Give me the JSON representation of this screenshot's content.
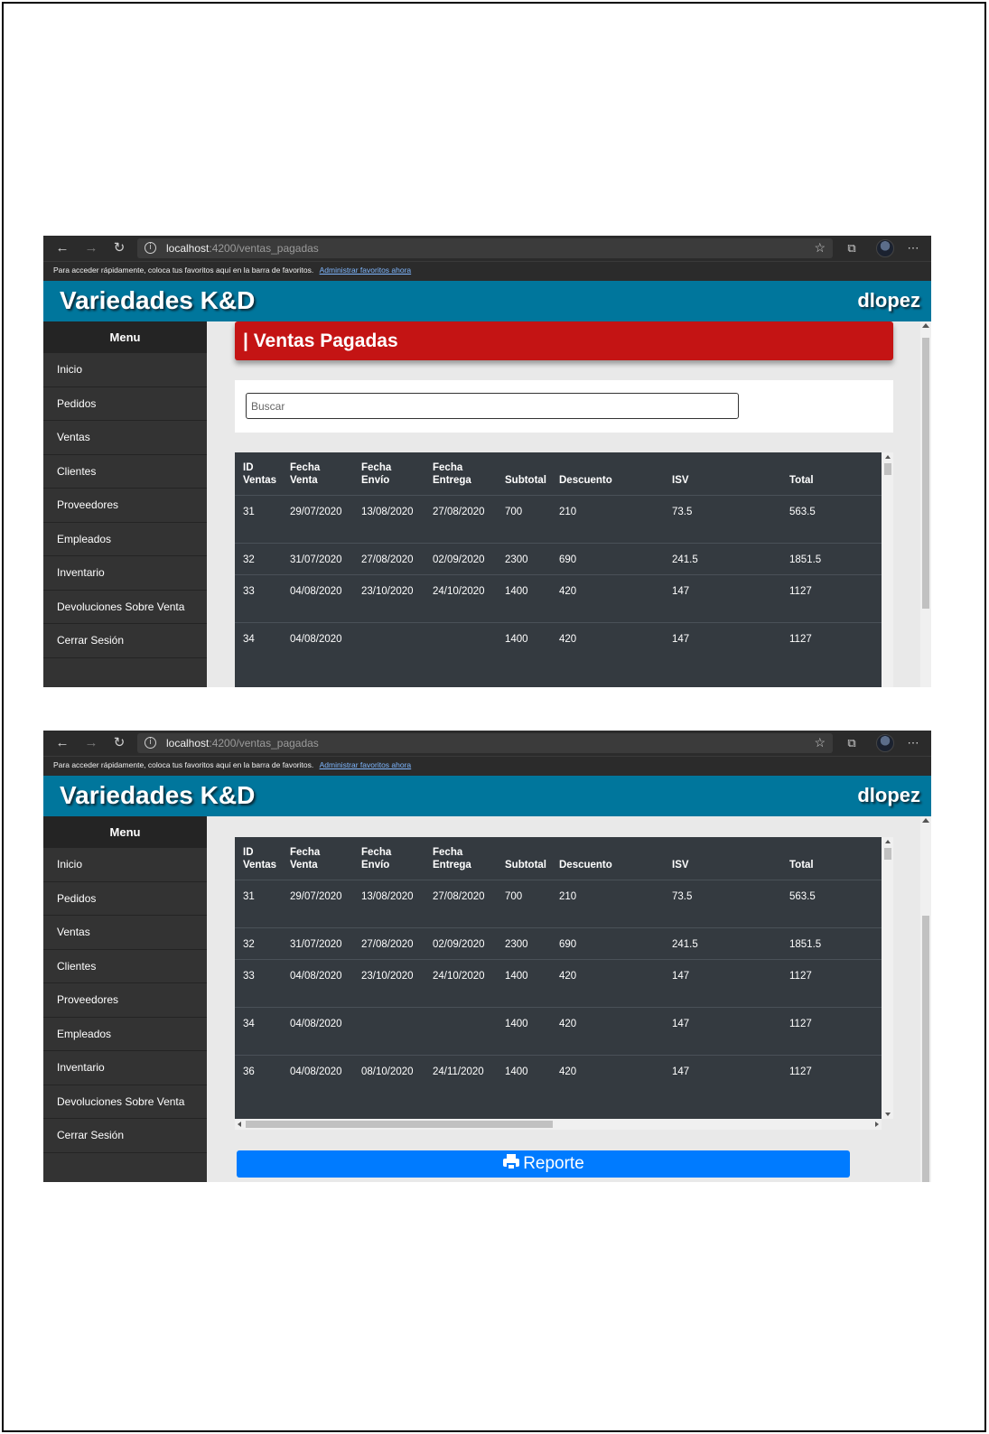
{
  "browser": {
    "url_host": "localhost",
    "url_path": ":4200/ventas_pagadas",
    "favorites_text": "Para acceder rápidamente, coloca tus favoritos aquí en la barra de favoritos.",
    "favorites_link": "Administrar favoritos ahora"
  },
  "app": {
    "title": "Variedades K&D",
    "user": "dlopez",
    "brand_color": "#00769c"
  },
  "sidebar": {
    "heading": "Menu",
    "items": [
      "Inicio",
      "Pedidos",
      "Ventas",
      "Clientes",
      "Proveedores",
      "Empleados",
      "Inventario",
      "Devoluciones Sobre Venta",
      "Cerrar Sesión"
    ]
  },
  "page": {
    "title": "| Ventas Pagadas",
    "title_color": "#c41414",
    "search_placeholder": "Buscar",
    "report_label": "Reporte",
    "report_color": "#007bff"
  },
  "table": {
    "headers": [
      [
        "ID",
        "Ventas"
      ],
      [
        "Fecha",
        "Venta"
      ],
      [
        "Fecha",
        "Envío"
      ],
      [
        "Fecha",
        "Entrega"
      ],
      [
        "",
        "Subtotal"
      ],
      [
        "",
        "Descuento"
      ],
      [
        "",
        "ISV"
      ],
      [
        "",
        "Total"
      ]
    ],
    "rows": [
      [
        "31",
        "29/07/2020",
        "13/08/2020",
        "27/08/2020",
        "700",
        "210",
        "73.5",
        "563.5"
      ],
      [
        "32",
        "31/07/2020",
        "27/08/2020",
        "02/09/2020",
        "2300",
        "690",
        "241.5",
        "1851.5"
      ],
      [
        "33",
        "04/08/2020",
        "23/10/2020",
        "24/10/2020",
        "1400",
        "420",
        "147",
        "1127"
      ],
      [
        "34",
        "04/08/2020",
        "",
        "",
        "1400",
        "420",
        "147",
        "1127"
      ],
      [
        "36",
        "04/08/2020",
        "08/10/2020",
        "24/11/2020",
        "1400",
        "420",
        "147",
        "1127"
      ]
    ]
  },
  "icons": {
    "back": "back-arrow-icon",
    "forward": "forward-arrow-icon",
    "refresh": "refresh-icon",
    "info": "info-icon",
    "favorite": "star-icon",
    "collections": "collections-icon",
    "menu": "more-icon",
    "print": "printer-icon"
  }
}
